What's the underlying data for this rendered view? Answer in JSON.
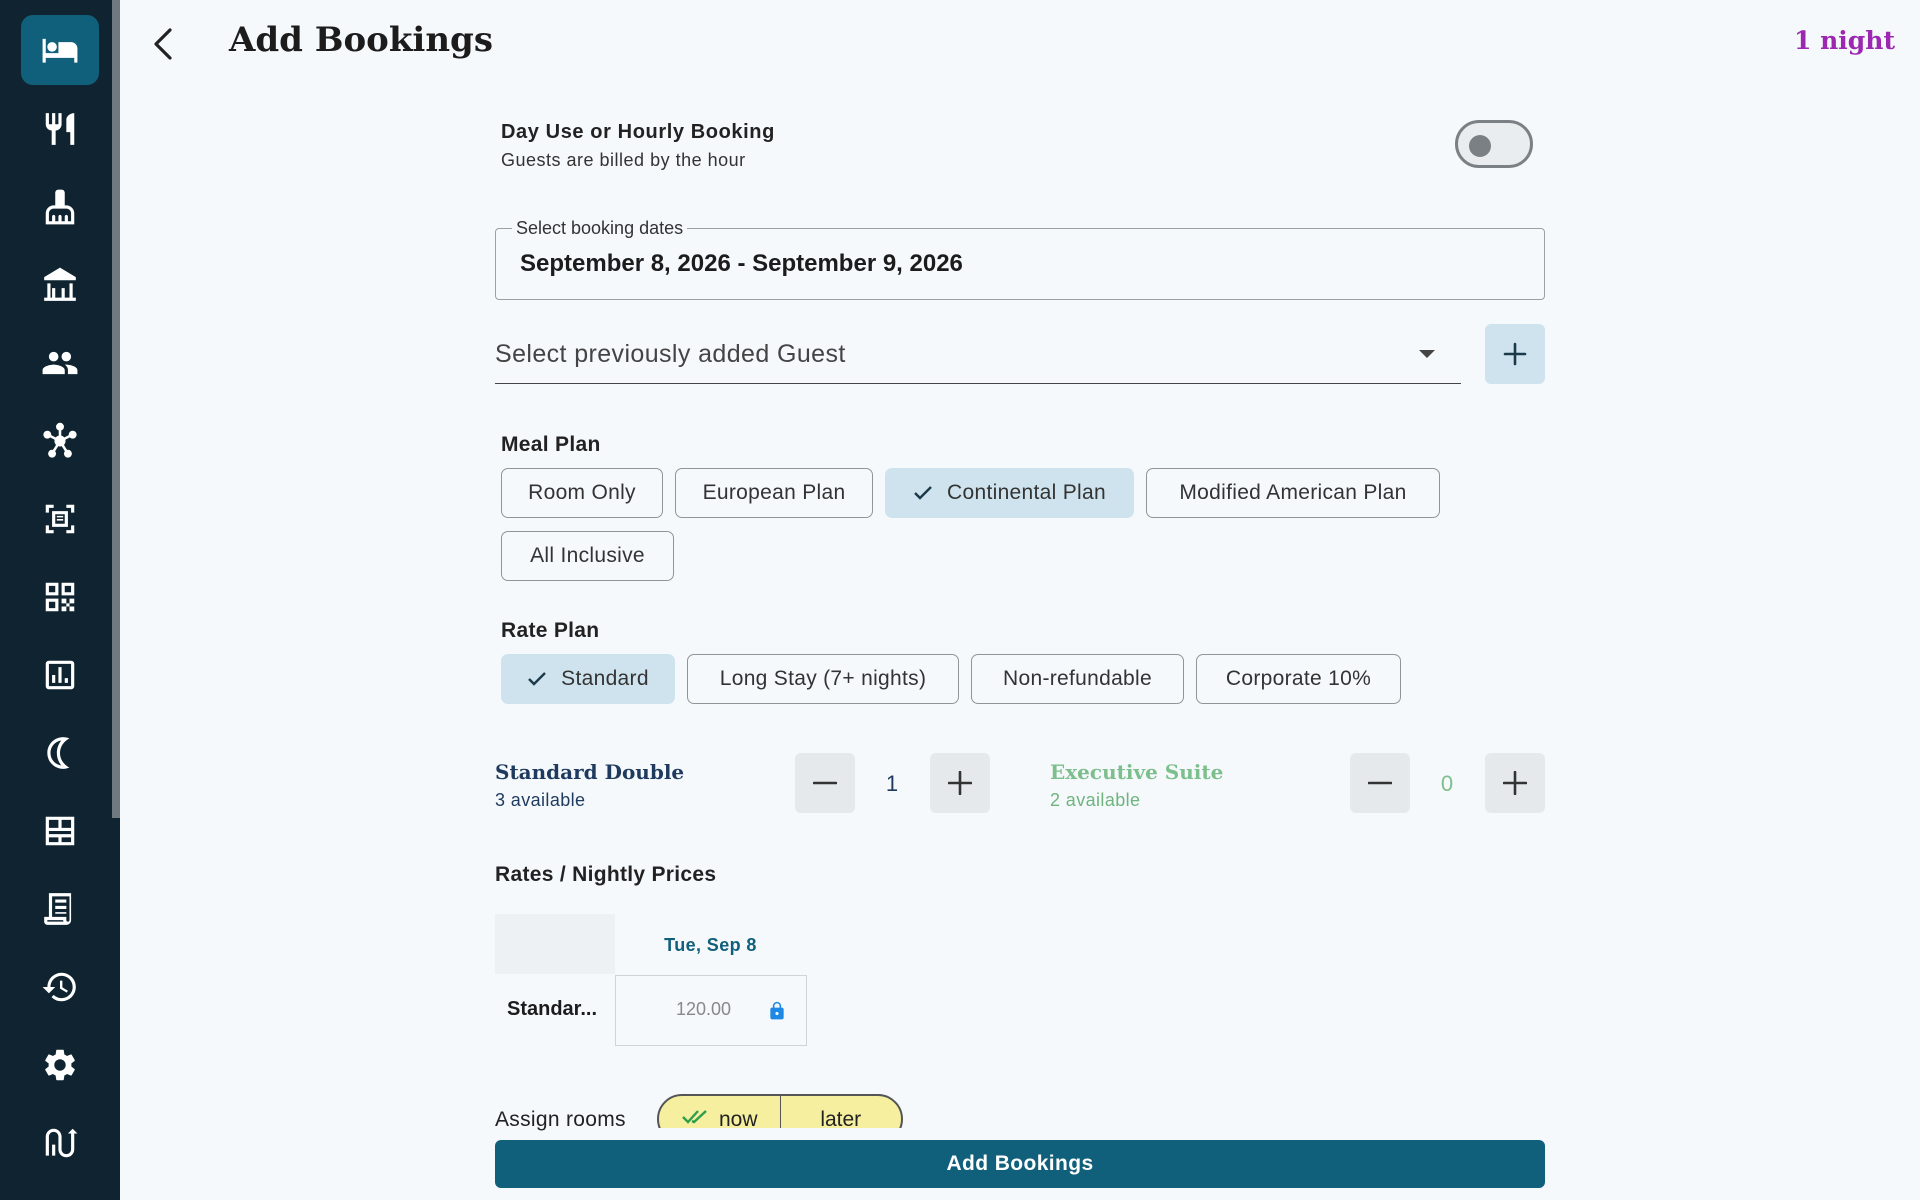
{
  "header": {
    "title": "Add Bookings",
    "nights": "1 night"
  },
  "sidebar": {
    "items": [
      {
        "icon": "bed-icon",
        "active": true
      },
      {
        "icon": "restaurant-icon",
        "active": false
      },
      {
        "icon": "housekeeping-icon",
        "active": false
      },
      {
        "icon": "property-icon",
        "active": false
      },
      {
        "icon": "guests-icon",
        "active": false
      },
      {
        "icon": "network-icon",
        "active": false
      },
      {
        "icon": "receipt-icon",
        "active": false
      },
      {
        "icon": "qr-code-icon",
        "active": false
      },
      {
        "icon": "reports-icon",
        "active": false
      },
      {
        "icon": "night-audit-icon",
        "active": false
      },
      {
        "icon": "rooms-grid-icon",
        "active": false
      },
      {
        "icon": "invoice-icon",
        "active": false
      },
      {
        "icon": "history-icon",
        "active": false
      },
      {
        "icon": "settings-icon",
        "active": false
      },
      {
        "icon": "channel-icon",
        "active": false
      }
    ]
  },
  "day_use": {
    "title": "Day Use or Hourly Booking",
    "subtitle": "Guests are billed by the hour",
    "enabled": false
  },
  "dates": {
    "label": "Select booking dates",
    "value": "September 8, 2026 - September 9, 2026"
  },
  "guest": {
    "placeholder": "Select previously added Guest"
  },
  "meal_plan": {
    "label": "Meal Plan",
    "options": [
      "Room Only",
      "European Plan",
      "Continental Plan",
      "Modified American Plan",
      "All Inclusive"
    ],
    "selected": "Continental Plan"
  },
  "rate_plan": {
    "label": "Rate Plan",
    "options": [
      "Standard",
      "Long Stay (7+ nights)",
      "Non-refundable",
      "Corporate 10%"
    ],
    "selected": "Standard"
  },
  "rooms": [
    {
      "name": "Standard Double",
      "available": "3 available",
      "qty": "1",
      "color": "#1f3a5f",
      "avail_color": "#1f3a5f"
    },
    {
      "name": "Executive Suite",
      "available": "2 available",
      "qty": "0",
      "color": "#7dbf8c",
      "avail_color": "#6fb47f"
    }
  ],
  "rates": {
    "title": "Rates / Nightly Prices",
    "date": "Tue, Sep 8",
    "room": "Standar...",
    "price": "120.00",
    "locked": true
  },
  "assign": {
    "label": "Assign rooms",
    "now": "now",
    "later": "later"
  },
  "submit": {
    "label": "Add Bookings"
  },
  "colors": {
    "primary": "#11607b",
    "accent": "#9c27b0",
    "selected_chip": "#cfe3ee",
    "sidebar_bg": "#0f2430"
  }
}
